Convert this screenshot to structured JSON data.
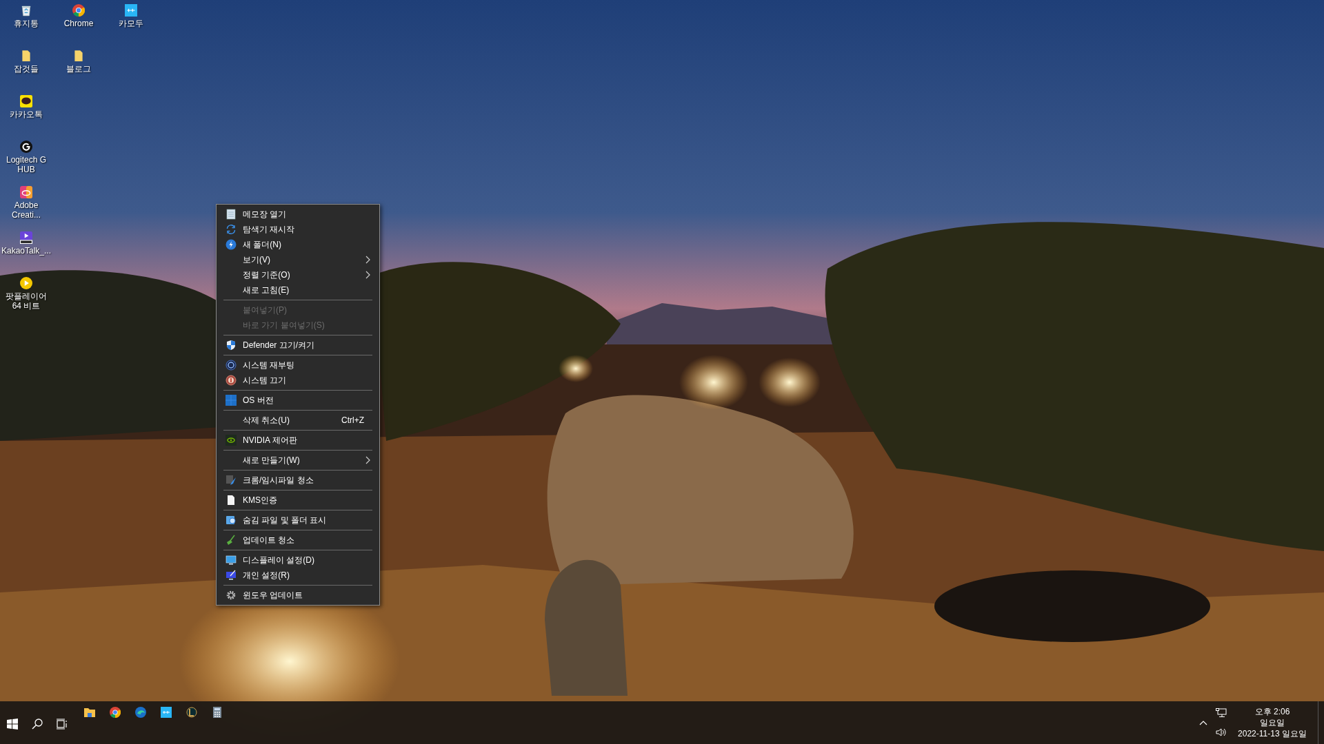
{
  "desktop": {
    "columns": [
      [
        {
          "label": "휴지통"
        },
        {
          "label": "잡것들"
        },
        {
          "label": "카카오톡"
        },
        {
          "label": "Logitech G HUB"
        },
        {
          "label": "Adobe Creati..."
        },
        {
          "label": "KakaoTalk_..."
        },
        {
          "label": "팟플레이어 64 비트"
        }
      ],
      [
        {
          "label": "Chrome"
        },
        {
          "label": "블로그"
        }
      ],
      [
        {
          "label": "카모두"
        }
      ]
    ]
  },
  "context_menu": {
    "groups": [
      [
        {
          "label": "메모장 열기",
          "disabled": false,
          "submenu": false
        },
        {
          "label": "탐색기 재시작",
          "disabled": false,
          "submenu": false
        },
        {
          "label": "새 폴더(N)",
          "disabled": false,
          "submenu": false
        },
        {
          "label": "보기(V)",
          "disabled": false,
          "submenu": true
        },
        {
          "label": "정렬 기준(O)",
          "disabled": false,
          "submenu": true
        },
        {
          "label": "새로 고침(E)",
          "disabled": false,
          "submenu": false
        }
      ],
      [
        {
          "label": "붙여넣기(P)",
          "disabled": true,
          "submenu": false
        },
        {
          "label": "바로 가기 붙여넣기(S)",
          "disabled": true,
          "submenu": false
        }
      ],
      [
        {
          "label": "Defender 끄기/켜기",
          "disabled": false,
          "submenu": false
        }
      ],
      [
        {
          "label": "시스템 재부팅",
          "disabled": false,
          "submenu": false
        },
        {
          "label": "시스템 끄기",
          "disabled": false,
          "submenu": false
        }
      ],
      [
        {
          "label": "OS 버전",
          "disabled": false,
          "submenu": false
        }
      ],
      [
        {
          "label": "삭제 취소(U)",
          "shortcut": "Ctrl+Z",
          "disabled": false,
          "submenu": false
        }
      ],
      [
        {
          "label": "NVIDIA 제어판",
          "disabled": false,
          "submenu": false
        }
      ],
      [
        {
          "label": "새로 만들기(W)",
          "disabled": false,
          "submenu": true
        }
      ],
      [
        {
          "label": "크롬/임시파일 청소",
          "disabled": false,
          "submenu": false
        }
      ],
      [
        {
          "label": "KMS인증",
          "disabled": false,
          "submenu": false
        }
      ],
      [
        {
          "label": "숨김 파일 및 폴더 표시",
          "disabled": false,
          "submenu": false
        }
      ],
      [
        {
          "label": "업데이트 청소",
          "disabled": false,
          "submenu": false
        }
      ],
      [
        {
          "label": "디스플레이 설정(D)",
          "disabled": false,
          "submenu": false
        },
        {
          "label": "개인 설정(R)",
          "disabled": false,
          "submenu": false
        }
      ],
      [
        {
          "label": "윈도우 업데이트",
          "disabled": false,
          "submenu": false
        }
      ]
    ]
  },
  "tray": {
    "time": "오후 2:06",
    "day": "일요일",
    "date": "2022-11-13 일요일"
  }
}
